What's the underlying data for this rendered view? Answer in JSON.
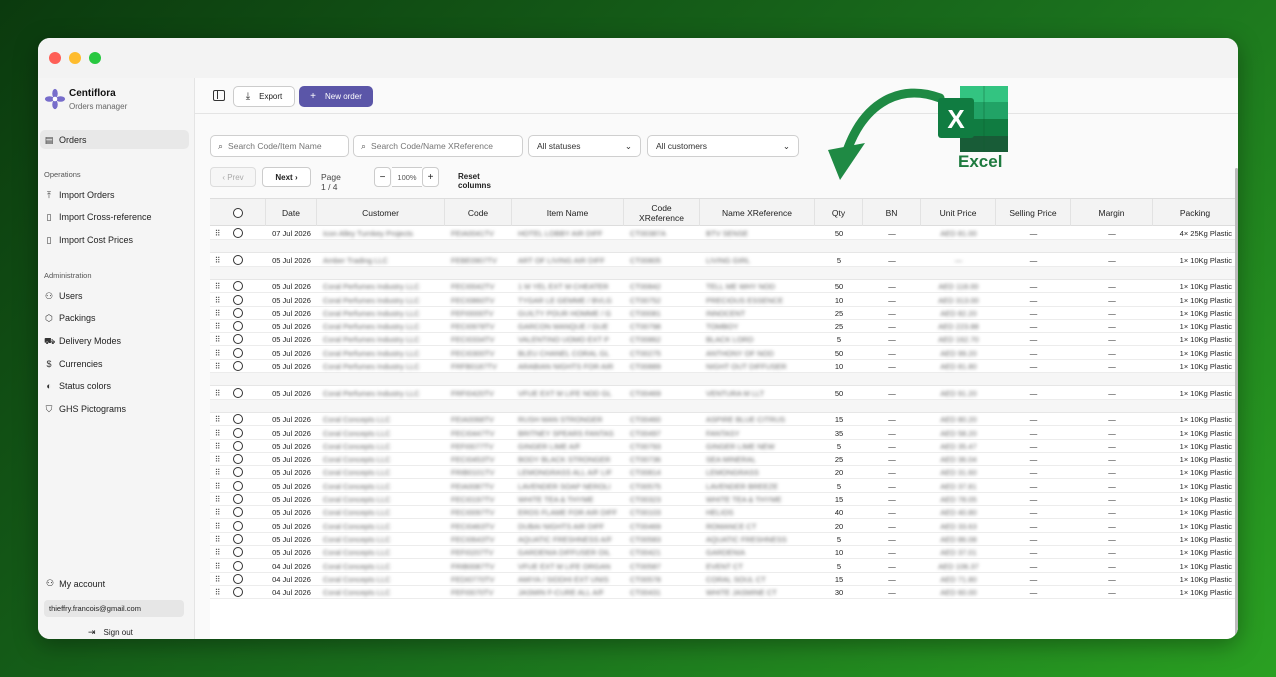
{
  "window": {
    "colors": {
      "close": "#fe5f57",
      "minimize": "#febc2e",
      "zoom": "#28c840"
    }
  },
  "brand": {
    "name": "Centiflora",
    "subtitle": "Orders manager",
    "logo_icon": "flower-icon"
  },
  "sidebar": {
    "primary": [
      {
        "label": "Orders",
        "icon": "clipboard-icon",
        "active": true
      }
    ],
    "sections": [
      {
        "label": "Operations",
        "items": [
          {
            "label": "Import Orders",
            "icon": "upload-icon"
          },
          {
            "label": "Import Cross-reference",
            "icon": "file-icon"
          },
          {
            "label": "Import Cost Prices",
            "icon": "file-icon"
          }
        ]
      },
      {
        "label": "Administration",
        "items": [
          {
            "label": "Users",
            "icon": "users-icon"
          },
          {
            "label": "Packings",
            "icon": "box-icon"
          },
          {
            "label": "Delivery Modes",
            "icon": "truck-icon"
          },
          {
            "label": "Currencies",
            "icon": "dollar-icon"
          },
          {
            "label": "Status colors",
            "icon": "palette-icon"
          },
          {
            "label": "GHS Pictograms",
            "icon": "shield-icon"
          }
        ]
      }
    ],
    "account_label": "My account",
    "email": "thieffry.francois@gmail.com",
    "sign_out": "Sign out"
  },
  "toolbar": {
    "export_label": "Export",
    "new_order_label": "New order",
    "accent": "#5b56a8"
  },
  "filters": {
    "search_code_item_placeholder": "Search Code/Item Name",
    "search_xref_placeholder": "Search Code/Name XReference",
    "status_value": "All statuses",
    "customer_value": "All customers"
  },
  "pagination": {
    "prev": "Prev",
    "next": "Next",
    "page_label": "Page 1 / 4",
    "zoom": "100%",
    "reset_columns": "Reset columns",
    "minus": "−",
    "plus": "+"
  },
  "table": {
    "columns": [
      "",
      "Date",
      "Customer",
      "Code",
      "Item Name",
      "Code XReference",
      "Name XReference",
      "Qty",
      "BN",
      "Unit Price",
      "Selling Price",
      "Margin",
      "Packing"
    ],
    "rows": [
      {
        "date": "07 Jul 2026",
        "customer": "Icon Alley Turnkey Projects",
        "code": "FEIA0041TV",
        "item": "HOTEL LOBBY AIR DIFF",
        "xcode": "CT00387A",
        "xname": "BTV SENSE",
        "qty": "50",
        "bn": "—",
        "unit": "AED 81.00",
        "sell": "—",
        "margin": "—",
        "packing": "4× 25Kg Plastic",
        "spacer_after": true
      },
      {
        "date": "05 Jul 2026",
        "customer": "Amber Trading LLC",
        "code": "FEBE0907TV",
        "item": "ART OF LIVING AIR DIFF",
        "xcode": "CT00805",
        "xname": "LIVING GIRL",
        "qty": "5",
        "bn": "—",
        "unit": "—",
        "sell": "—",
        "margin": "—",
        "packing": "1× 10Kg Plastic",
        "spacer_after": true
      },
      {
        "date": "05 Jul 2026",
        "customer": "Coral Perfumes Industry LLC",
        "code": "FECI0042TV",
        "item": "1 M YEL EXT M CHEATER",
        "xcode": "CT00842",
        "xname": "TELL ME WHY NOD",
        "qty": "50",
        "bn": "—",
        "unit": "AED 118.00",
        "sell": "—",
        "margin": "—",
        "packing": "1× 10Kg Plastic"
      },
      {
        "date": "05 Jul 2026",
        "customer": "Coral Perfumes Industry LLC",
        "code": "FECI0860TV",
        "item": "TYGAR LE GEMME / BVLG",
        "xcode": "CT00752",
        "xname": "PRECIOUS ESSENCE",
        "qty": "10",
        "bn": "—",
        "unit": "AED 313.00",
        "sell": "—",
        "margin": "—",
        "packing": "1× 10Kg Plastic"
      },
      {
        "date": "05 Jul 2026",
        "customer": "Coral Perfumes Industry LLC",
        "code": "FEFI0000TV",
        "item": "GUILTY POUR HOMME / G",
        "xcode": "CT00081",
        "xname": "INNOCENT",
        "qty": "25",
        "bn": "—",
        "unit": "AED 82.20",
        "sell": "—",
        "margin": "—",
        "packing": "1× 10Kg Plastic"
      },
      {
        "date": "05 Jul 2026",
        "customer": "Coral Perfumes Industry LLC",
        "code": "FECI0978TV",
        "item": "GARCON MANQUE / GUE",
        "xcode": "CT00798",
        "xname": "TOMBOY",
        "qty": "25",
        "bn": "—",
        "unit": "AED 223.88",
        "sell": "—",
        "margin": "—",
        "packing": "1× 10Kg Plastic"
      },
      {
        "date": "05 Jul 2026",
        "customer": "Coral Perfumes Industry LLC",
        "code": "FECI0334TV",
        "item": "VALENTINO UOMO EXT P",
        "xcode": "CT00862",
        "xname": "BLACK LORD",
        "qty": "5",
        "bn": "—",
        "unit": "AED 162.70",
        "sell": "—",
        "margin": "—",
        "packing": "1× 10Kg Plastic"
      },
      {
        "date": "05 Jul 2026",
        "customer": "Coral Perfumes Industry LLC",
        "code": "FECI0300TV",
        "item": "BLEU CHANEL CORAL GL",
        "xcode": "CT00275",
        "xname": "ANTHONY OF NOD",
        "qty": "50",
        "bn": "—",
        "unit": "AED 99.20",
        "sell": "—",
        "margin": "—",
        "packing": "1× 10Kg Plastic"
      },
      {
        "date": "05 Jul 2026",
        "customer": "Coral Perfumes Industry LLC",
        "code": "FRFB0187TV",
        "item": "ARABIAN NIGHTS FOR AIR",
        "xcode": "CT00889",
        "xname": "NIGHT OUT DIFFUSER",
        "qty": "10",
        "bn": "—",
        "unit": "AED 81.80",
        "sell": "—",
        "margin": "—",
        "packing": "1× 10Kg Plastic",
        "spacer_after": true
      },
      {
        "date": "05 Jul 2026",
        "customer": "Coral Perfumes Industry LLC",
        "code": "FRFI0420TV",
        "item": "VFUE EXT M LIFE NOD GL",
        "xcode": "CT00469",
        "xname": "VENTURA M LLT",
        "qty": "50",
        "bn": "—",
        "unit": "AED 91.20",
        "sell": "—",
        "margin": "—",
        "packing": "1× 10Kg Plastic",
        "spacer_after": true
      },
      {
        "date": "05 Jul 2026",
        "customer": "Coral Concepts LLC",
        "code": "FEIA0068TV",
        "item": "RUSH MAN STRONGER",
        "xcode": "CT00460",
        "xname": "ASPIRE BLUE CITRUS",
        "qty": "15",
        "bn": "—",
        "unit": "AED 80.20",
        "sell": "—",
        "margin": "—",
        "packing": "1× 10Kg Plastic"
      },
      {
        "date": "05 Jul 2026",
        "customer": "Coral Concepts LLC",
        "code": "FECI0447TV",
        "item": "BRITNEY SPEARS FANTAS",
        "xcode": "CT00497",
        "xname": "FANTASY",
        "qty": "35",
        "bn": "—",
        "unit": "AED 58.20",
        "sell": "—",
        "margin": "—",
        "packing": "1× 10Kg Plastic"
      },
      {
        "date": "05 Jul 2026",
        "customer": "Coral Concepts LLC",
        "code": "FEFI0077TV",
        "item": "GINGER LIME A/F",
        "xcode": "CT00793",
        "xname": "GINGER LIME NEW",
        "qty": "5",
        "bn": "—",
        "unit": "AED 35.47",
        "sell": "—",
        "margin": "—",
        "packing": "1× 10Kg Plastic"
      },
      {
        "date": "05 Jul 2026",
        "customer": "Coral Concepts LLC",
        "code": "FECI0453TV",
        "item": "BODY BLACK STRONGER",
        "xcode": "CT00736",
        "xname": "SEA MINERAL",
        "qty": "25",
        "bn": "—",
        "unit": "AED 36.04",
        "sell": "—",
        "margin": "—",
        "packing": "1× 10Kg Plastic"
      },
      {
        "date": "05 Jul 2026",
        "customer": "Coral Concepts LLC",
        "code": "FRIB0101TV",
        "item": "LEMONGRASS ALL A/F LIF",
        "xcode": "CT00814",
        "xname": "LEMONGRASS",
        "qty": "20",
        "bn": "—",
        "unit": "AED 31.60",
        "sell": "—",
        "margin": "—",
        "packing": "1× 10Kg Plastic"
      },
      {
        "date": "05 Jul 2026",
        "customer": "Coral Concepts LLC",
        "code": "FEIA0087TV",
        "item": "LAVENDER SOAP NEROLI",
        "xcode": "CT00575",
        "xname": "LAVENDER BREEZE",
        "qty": "5",
        "bn": "—",
        "unit": "AED 37.81",
        "sell": "—",
        "margin": "—",
        "packing": "1× 10Kg Plastic"
      },
      {
        "date": "05 Jul 2026",
        "customer": "Coral Concepts LLC",
        "code": "FECI0197TV",
        "item": "WHITE TEA & THYME",
        "xcode": "CT00323",
        "xname": "WHITE TEA & THYME",
        "qty": "15",
        "bn": "—",
        "unit": "AED 78.05",
        "sell": "—",
        "margin": "—",
        "packing": "1× 10Kg Plastic"
      },
      {
        "date": "05 Jul 2026",
        "customer": "Coral Concepts LLC",
        "code": "FECI0097TV",
        "item": "EROS FLAME FOR AIR DIFF",
        "xcode": "CT00103",
        "xname": "HELIOS",
        "qty": "40",
        "bn": "—",
        "unit": "AED 40.80",
        "sell": "—",
        "margin": "—",
        "packing": "1× 10Kg Plastic"
      },
      {
        "date": "05 Jul 2026",
        "customer": "Coral Concepts LLC",
        "code": "FECI0463TV",
        "item": "DUBAI NIGHTS AIR DIFF",
        "xcode": "CT00469",
        "xname": "ROMANCE CT",
        "qty": "20",
        "bn": "—",
        "unit": "AED 33.63",
        "sell": "—",
        "margin": "—",
        "packing": "1× 10Kg Plastic"
      },
      {
        "date": "05 Jul 2026",
        "customer": "Coral Concepts LLC",
        "code": "FECI0643TV",
        "item": "AQUATIC FRESHNESS A/F",
        "xcode": "CT00583",
        "xname": "AQUATIC FRESHNESS",
        "qty": "5",
        "bn": "—",
        "unit": "AED 86.08",
        "sell": "—",
        "margin": "—",
        "packing": "1× 10Kg Plastic"
      },
      {
        "date": "05 Jul 2026",
        "customer": "Coral Concepts LLC",
        "code": "FEFI0207TV",
        "item": "GARDENIA DIFFUSER OIL",
        "xcode": "CT00421",
        "xname": "GARDENIA",
        "qty": "10",
        "bn": "—",
        "unit": "AED 37.01",
        "sell": "—",
        "margin": "—",
        "packing": "1× 10Kg Plastic"
      },
      {
        "date": "04 Jul 2026",
        "customer": "Coral Concepts LLC",
        "code": "FRIB0087TV",
        "item": "VFUE EXT M LIFE ORGAN",
        "xcode": "CT00587",
        "xname": "EVENT CT",
        "qty": "5",
        "bn": "—",
        "unit": "AED 106.37",
        "sell": "—",
        "margin": "—",
        "packing": "1× 10Kg Plastic"
      },
      {
        "date": "04 Jul 2026",
        "customer": "Coral Concepts LLC",
        "code": "FEDI0770TV",
        "item": "AMIYA / SIDDHI EXT UNIS",
        "xcode": "CT00578",
        "xname": "CORAL SOUL CT",
        "qty": "15",
        "bn": "—",
        "unit": "AED 71.80",
        "sell": "—",
        "margin": "—",
        "packing": "1× 10Kg Plastic"
      },
      {
        "date": "04 Jul 2026",
        "customer": "Coral Concepts LLC",
        "code": "FEFI0070TV",
        "item": "JASMIN F-CURE ALL A/F",
        "xcode": "CT00431",
        "xname": "WHITE JASMINE CT",
        "qty": "30",
        "bn": "—",
        "unit": "AED 60.00",
        "sell": "—",
        "margin": "—",
        "packing": "1× 10Kg Plastic"
      }
    ]
  },
  "overlay": {
    "excel_label": "Excel",
    "excel_letter": "X",
    "arrow_color": "#1f8a44",
    "excel_colors": [
      "#21a366",
      "#107c41",
      "#185c37",
      "#33c481"
    ]
  }
}
